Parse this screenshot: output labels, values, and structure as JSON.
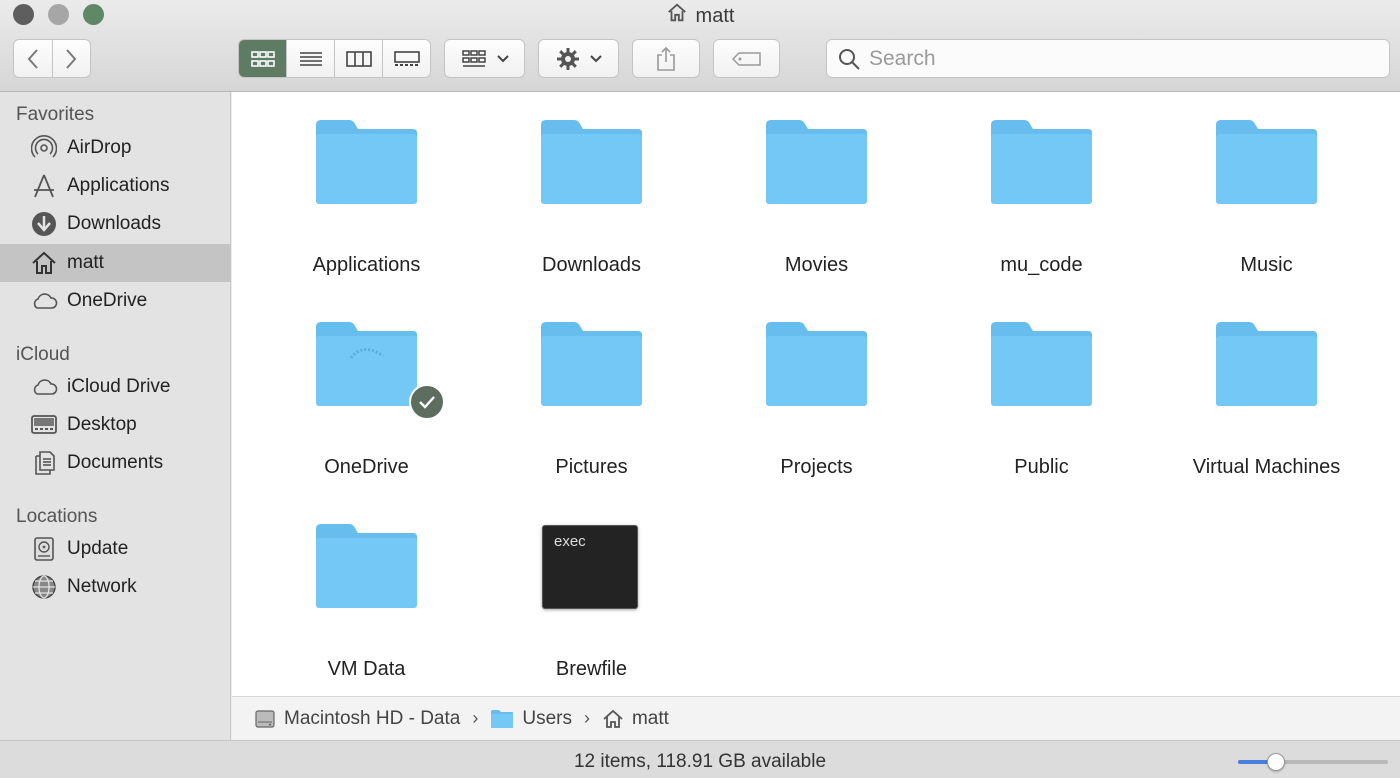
{
  "window": {
    "title": "matt",
    "title_icon": "home-icon"
  },
  "toolbar": {
    "back_icon": "chevron-left-icon",
    "forward_icon": "chevron-right-icon",
    "views": [
      "icon-view",
      "list-view",
      "column-view",
      "gallery-view"
    ],
    "active_view": "icon-view",
    "group_icon": "group-by-icon",
    "action_icon": "gear-icon",
    "share_icon": "share-icon",
    "tag_icon": "tag-icon",
    "search_placeholder": "Search"
  },
  "sidebar": {
    "sections": [
      {
        "header": "Favorites",
        "items": [
          {
            "label": "AirDrop",
            "icon": "airdrop-icon"
          },
          {
            "label": "Applications",
            "icon": "applications-icon"
          },
          {
            "label": "Downloads",
            "icon": "downloads-icon"
          },
          {
            "label": "matt",
            "icon": "home-icon",
            "selected": true
          },
          {
            "label": "OneDrive",
            "icon": "cloud-icon"
          }
        ]
      },
      {
        "header": "iCloud",
        "items": [
          {
            "label": "iCloud Drive",
            "icon": "cloud-icon"
          },
          {
            "label": "Desktop",
            "icon": "desktop-icon"
          },
          {
            "label": "Documents",
            "icon": "documents-icon"
          }
        ]
      },
      {
        "header": "Locations",
        "items": [
          {
            "label": "Update",
            "icon": "disk-icon"
          },
          {
            "label": "Network",
            "icon": "network-icon"
          }
        ]
      }
    ]
  },
  "files": [
    {
      "name": "Applications",
      "kind": "folder"
    },
    {
      "name": "Downloads",
      "kind": "folder"
    },
    {
      "name": "Movies",
      "kind": "folder"
    },
    {
      "name": "mu_code",
      "kind": "folder"
    },
    {
      "name": "Music",
      "kind": "folder"
    },
    {
      "name": "OneDrive",
      "kind": "folder",
      "badge": "synced"
    },
    {
      "name": "Pictures",
      "kind": "folder"
    },
    {
      "name": "Projects",
      "kind": "folder"
    },
    {
      "name": "Public",
      "kind": "folder"
    },
    {
      "name": "Virtual Machines",
      "kind": "folder"
    },
    {
      "name": "VM Data",
      "kind": "folder"
    },
    {
      "name": "Brewfile",
      "kind": "exec",
      "icon_text": "exec"
    }
  ],
  "pathbar": {
    "crumbs": [
      {
        "label": "Macintosh HD - Data",
        "icon": "disk-icon"
      },
      {
        "label": "Users",
        "icon": "folder-icon"
      },
      {
        "label": "matt",
        "icon": "home-icon"
      }
    ],
    "separator": "›"
  },
  "status": {
    "text": "12 items, 118.91 GB available",
    "icon_size_level": 0.25
  },
  "colors": {
    "folder": "#73c8f5",
    "folder_tab": "#66bdee",
    "active_view": "#5e7c64",
    "sidebar_selected": "#c4c4c4",
    "badge": "#5d6d60"
  }
}
